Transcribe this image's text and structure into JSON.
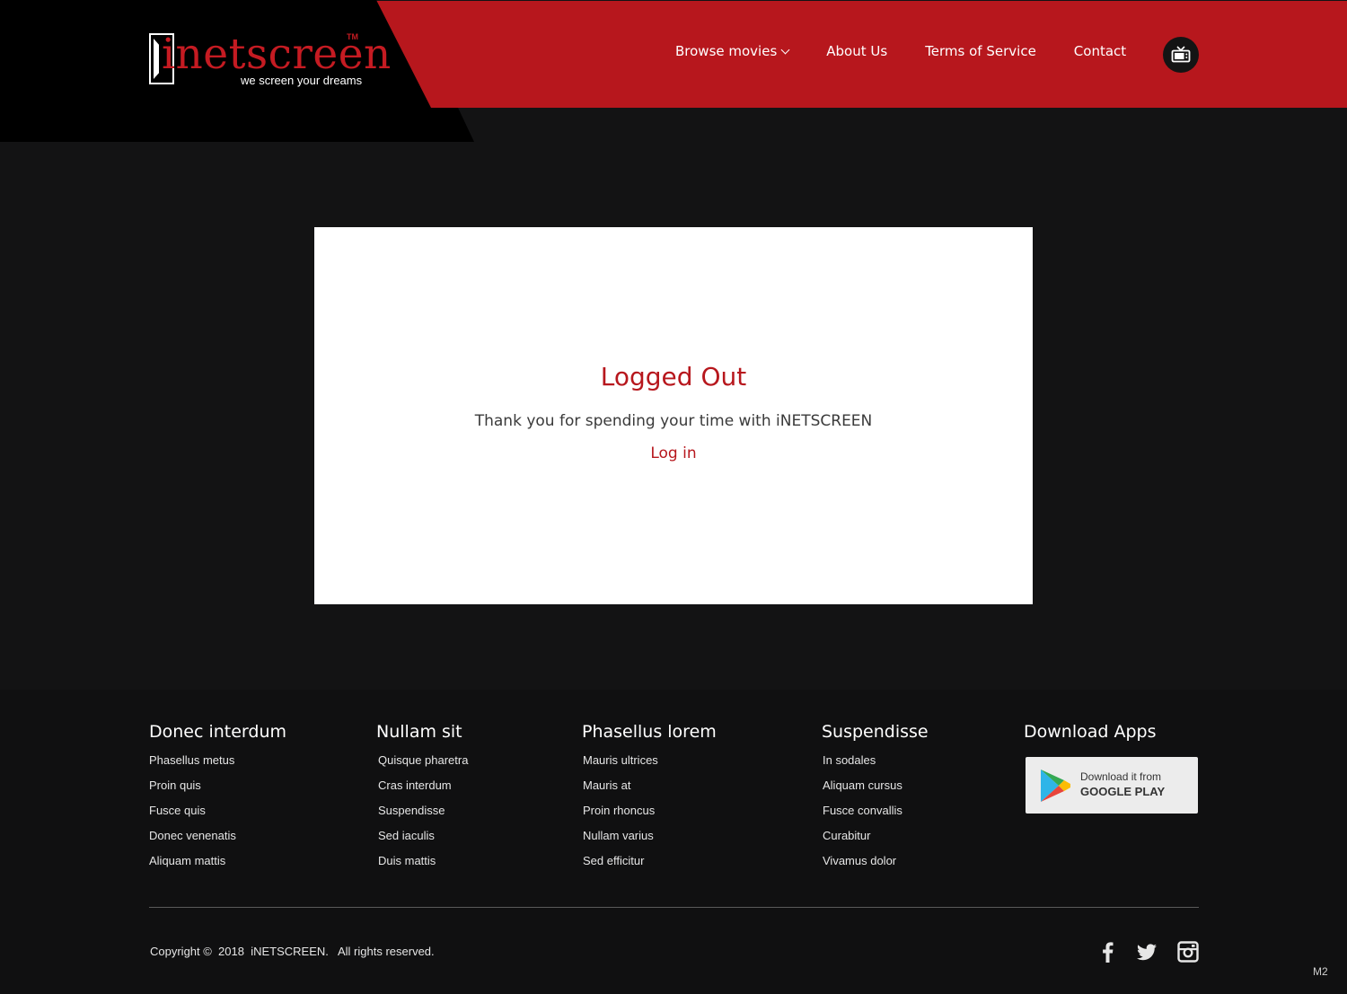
{
  "header": {
    "logo": {
      "wordmark": "inetscreen",
      "trademark": "TM",
      "tagline": "we screen your dreams"
    },
    "nav": {
      "browse": "Browse movies",
      "about": "About Us",
      "terms": "Terms of Service",
      "contact": "Contact"
    },
    "tv_icon": "tv-icon"
  },
  "card": {
    "title": "Logged Out",
    "message": "Thank you for spending your time with iNETSCREEN",
    "login_link": "Log in"
  },
  "footer": {
    "columns": [
      {
        "heading": "Donec interdum",
        "items": [
          "Phasellus metus",
          "Proin quis",
          "Fusce quis",
          "Donec venenatis",
          "Aliquam mattis"
        ]
      },
      {
        "heading": "Nullam sit",
        "items": [
          "Quisque pharetra",
          "Cras interdum",
          "Suspendisse",
          "Sed iaculis",
          "Duis mattis"
        ]
      },
      {
        "heading": "Phasellus lorem",
        "items": [
          "Mauris ultrices",
          "Mauris at",
          "Proin rhoncus",
          "Nullam varius",
          "Sed efficitur"
        ]
      },
      {
        "heading": "Suspendisse",
        "items": [
          "In sodales",
          "Aliquam cursus",
          "Fusce convallis",
          "Curabitur",
          "Vivamus dolor"
        ]
      }
    ],
    "apps": {
      "heading": "Download Apps",
      "badge_small": "Download it from",
      "badge_big": "GOOGLE PLAY"
    },
    "copyright": "Copyright ©  2018  iNETSCREEN.   All rights reserved.",
    "social": [
      "facebook-icon",
      "twitter-icon",
      "instagram-icon"
    ],
    "version": "M2"
  },
  "colors": {
    "brand_red": "#b7171d",
    "page_bg": "#131314",
    "footer_bg": "#101011"
  }
}
